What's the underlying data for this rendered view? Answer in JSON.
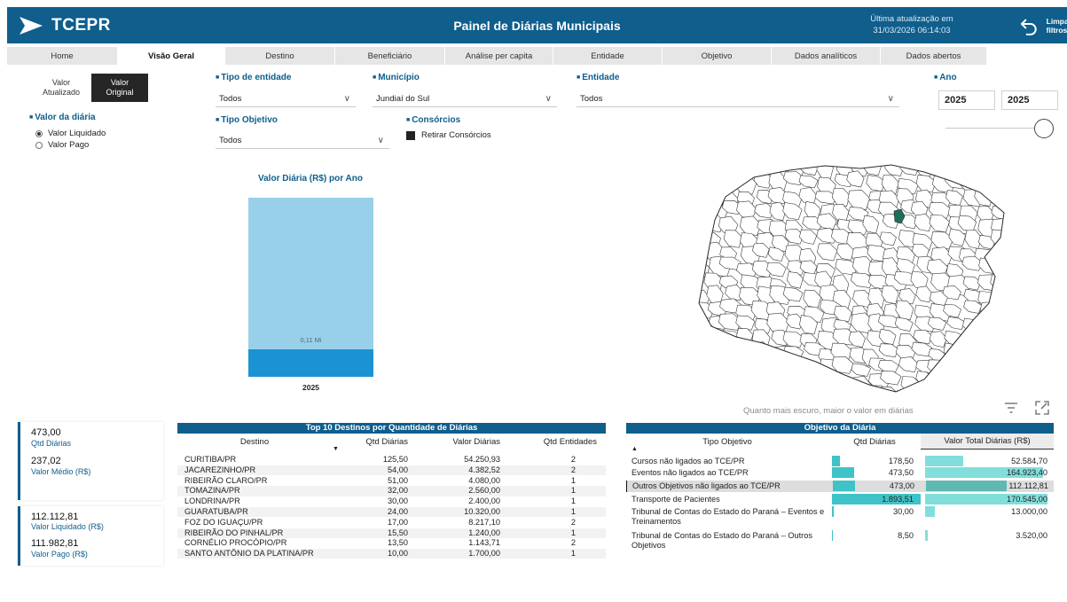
{
  "header": {
    "logo_text": "TCEPR",
    "title": "Painel de Diárias Municipais",
    "last_update_line1": "Última atualização em",
    "last_update_line2": "31/03/2026 06:14:03",
    "clear_filters_line1": "Limpar",
    "clear_filters_line2": "filtros"
  },
  "tabs": [
    "Home",
    "Visão Geral",
    "Destino",
    "Beneficiário",
    "Análise per capita",
    "Entidade",
    "Objetivo",
    "Dados analíticos",
    "Dados abertos"
  ],
  "active_tab": "Visão Geral",
  "value_toggle": {
    "off_line1": "Valor",
    "off_line2": "Atualizado",
    "on_line1": "Valor",
    "on_line2": "Original"
  },
  "filters": {
    "tipo_entidade": {
      "label": "Tipo de entidade",
      "value": "Todos"
    },
    "municipio": {
      "label": "Município",
      "value": "Jundiaí do Sul"
    },
    "entidade": {
      "label": "Entidade",
      "value": "Todos"
    },
    "ano": {
      "label": "Ano",
      "from": "2025",
      "to": "2025"
    },
    "valor_diaria": {
      "label": "Valor da diária",
      "options": [
        "Valor Liquidado",
        "Valor Pago"
      ],
      "selected": "Valor Liquidado"
    },
    "tipo_objetivo": {
      "label": "Tipo Objetivo",
      "value": "Todos"
    },
    "consorcios": {
      "label": "Consórcios",
      "checkbox_label": "Retirar Consórcios",
      "checked": true
    }
  },
  "chart_data": {
    "type": "bar",
    "title": "Valor Diária (R$) por Ano",
    "categories": [
      "2025"
    ],
    "series": [
      {
        "values": [
          0.02
        ],
        "color": "#1b92d2"
      },
      {
        "values": [
          0.11
        ],
        "color": "#98d0ea"
      }
    ],
    "stacked": true,
    "data_labels": [
      "0,11 Mi"
    ],
    "ylim": [
      0,
      0.13
    ],
    "unit": "Mi"
  },
  "map": {
    "caption": "Quanto mais escuro, maior o valor em diárias",
    "highlight_color": "#1e6e5c",
    "filter_icon": "filter-icon",
    "expand_icon": "focus-mode-icon"
  },
  "kpis": {
    "qtd_diarias": {
      "value": "473,00",
      "label": "Qtd Diárias"
    },
    "valor_medio": {
      "value": "237,02",
      "label": "Valor Médio (R$)"
    },
    "valor_liquidado": {
      "value": "112.112,81",
      "label": "Valor Liquidado (R$)"
    },
    "valor_pago": {
      "value": "111.982,81",
      "label": "Valor Pago (R$)"
    }
  },
  "top_destinos": {
    "title": "Top 10 Destinos por Quantidade de Diárias",
    "columns": [
      "Destino",
      "Qtd Diárias",
      "Valor Diárias",
      "Qtd Entidades"
    ],
    "rows": [
      [
        "CURITIBA/PR",
        "125,50",
        "54.250,93",
        "2"
      ],
      [
        "JACAREZINHO/PR",
        "54,00",
        "4.382,52",
        "2"
      ],
      [
        "RIBEIRÃO CLARO/PR",
        "51,00",
        "4.080,00",
        "1"
      ],
      [
        "TOMAZINA/PR",
        "32,00",
        "2.560,00",
        "1"
      ],
      [
        "LONDRINA/PR",
        "30,00",
        "2.400,00",
        "1"
      ],
      [
        "GUARATUBA/PR",
        "24,00",
        "10.320,00",
        "1"
      ],
      [
        "FOZ DO IGUAÇU/PR",
        "17,00",
        "8.217,10",
        "2"
      ],
      [
        "RIBEIRÃO DO PINHAL/PR",
        "15,50",
        "1.240,00",
        "1"
      ],
      [
        "CORNÉLIO PROCÓPIO/PR",
        "13,50",
        "1.143,71",
        "2"
      ],
      [
        "SANTO ANTÔNIO DA PLATINA/PR",
        "10,00",
        "1.700,00",
        "1"
      ]
    ]
  },
  "objetivo": {
    "title": "Objetivo da Diária",
    "columns": [
      "Tipo Objetivo",
      "Qtd Diárias",
      "Valor Total Diárias (R$)"
    ],
    "rows": [
      {
        "label": "Cursos não ligados ao TCE/PR",
        "qtd": "178,50",
        "qtd_num": 178.5,
        "valor": "52.584,70",
        "valor_num": 52584.7
      },
      {
        "label": "Eventos não ligados ao TCE/PR",
        "qtd": "473,50",
        "qtd_num": 473.5,
        "valor": "164.923,40",
        "valor_num": 164923.4
      },
      {
        "label": "Outros Objetivos não ligados ao TCE/PR",
        "qtd": "473,00",
        "qtd_num": 473.0,
        "valor": "112.112,81",
        "valor_num": 112112.81
      },
      {
        "label": "Transporte de Pacientes",
        "qtd": "1.893,51",
        "qtd_num": 1893.51,
        "valor": "170.545,00",
        "valor_num": 170545.0
      },
      {
        "label": "Tribunal de Contas do Estado do Paraná – Eventos e Treinamentos",
        "qtd": "30,00",
        "qtd_num": 30.0,
        "valor": "13.000,00",
        "valor_num": 13000.0
      },
      {
        "label": "Tribunal de Contas do Estado do Paraná – Outros Objetivos",
        "qtd": "8,50",
        "qtd_num": 8.5,
        "valor": "3.520,00",
        "valor_num": 3520.0
      }
    ],
    "selected_row": 2
  }
}
